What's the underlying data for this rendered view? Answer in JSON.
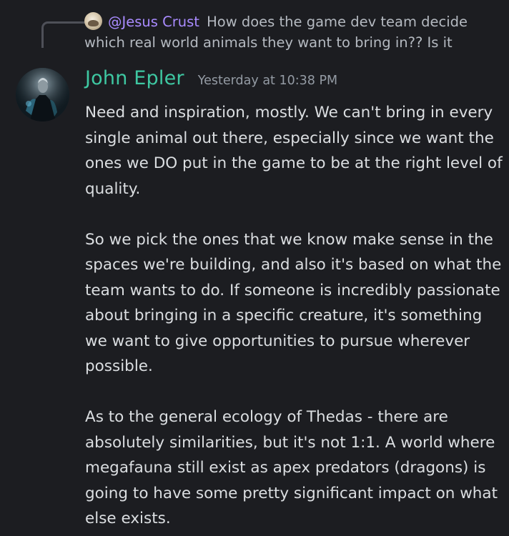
{
  "reply": {
    "author": "@Jesus Crust",
    "text": "How does the game dev team decide which real world animals they want to bring in?? Is it"
  },
  "message": {
    "author": "John Epler",
    "timestamp": "Yesterday at 10:38 PM",
    "paragraphs": [
      "Need and inspiration, mostly. We can't bring in every single animal out there, especially since we want the ones we DO put in the game to be at the right level of quality.",
      "So we pick the ones that we know make sense in the spaces we're building, and also it's based on what the team wants to do. If someone is incredibly passionate about bringing in a specific creature, it's something we want to give opportunities to pursue wherever possible.",
      "As to the general ecology of Thedas - there are absolutely similarities, but it's not 1:1. A world where megafauna still exist as apex predators (dragons) is going to have some pretty significant impact on what else exists."
    ]
  },
  "colors": {
    "background": "#1c1d21",
    "author_name": "#3ec8a2",
    "reply_author": "#a98bff",
    "text": "#dbdee1",
    "muted": "#949ba4"
  }
}
